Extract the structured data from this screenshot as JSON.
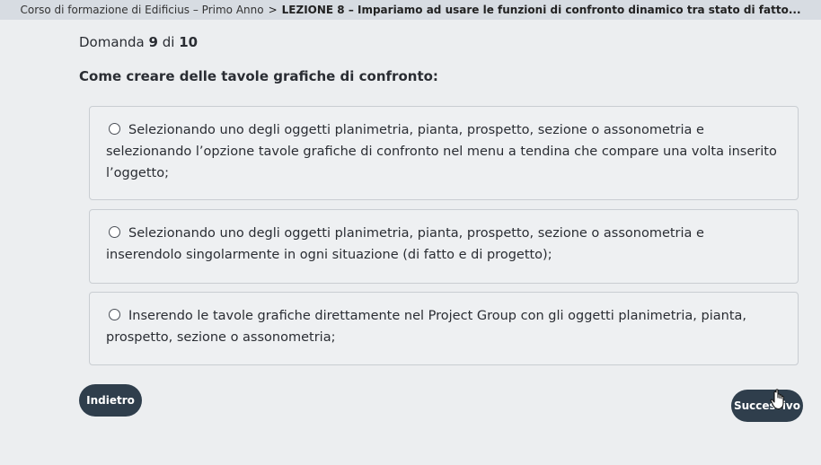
{
  "header": {
    "course": "Corso di formazione di Edificius – Primo Anno",
    "separator": ">",
    "lesson": "LEZIONE 8 – Impariamo ad usare le funzioni di confronto dinamico tra stato di fatto..."
  },
  "question": {
    "label": "Domanda",
    "number": "9",
    "of_label": "di",
    "total": "10",
    "title": "Come creare delle tavole grafiche di confronto:"
  },
  "options": [
    {
      "text": "Selezionando uno degli oggetti planimetria, pianta, prospetto, sezione o assonometria e selezionando l’opzione tavole grafiche di confronto nel menu a tendina che compare una volta inserito l’oggetto;"
    },
    {
      "text": "Selezionando uno degli oggetti planimetria, pianta, prospetto, sezione o assonometria e inserendolo singolarmente in ogni situazione (di fatto e di progetto);"
    },
    {
      "text": "Inserendo le tavole grafiche direttamente nel Project Group con gli oggetti planimetria, pianta, prospetto, sezione o assonometria;"
    }
  ],
  "buttons": {
    "back": "Indietro",
    "next": "Successivo"
  },
  "colors": {
    "button_bg": "#2f3e4c",
    "page_bg": "#eceef0",
    "topbar_bg": "#d7dce2"
  },
  "icons": [
    "radio-icon",
    "hand-pointer-cursor-icon"
  ]
}
